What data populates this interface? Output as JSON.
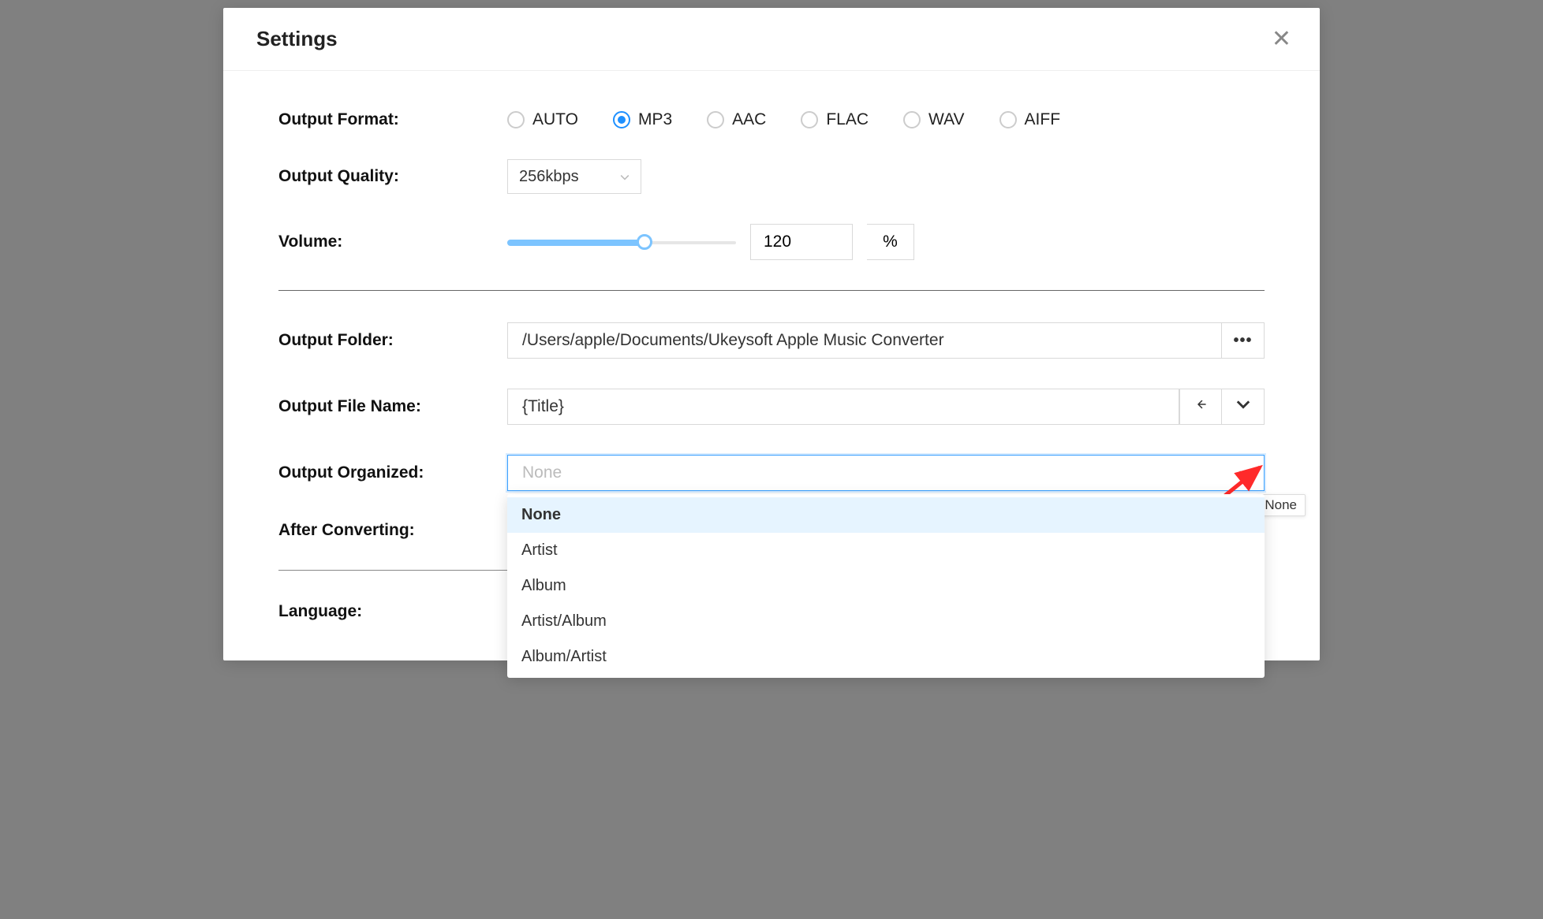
{
  "modal": {
    "title": "Settings"
  },
  "output_format": {
    "label": "Output Format:",
    "options": [
      "AUTO",
      "MP3",
      "AAC",
      "FLAC",
      "WAV",
      "AIFF"
    ],
    "selected": "MP3"
  },
  "output_quality": {
    "label": "Output Quality:",
    "value": "256kbps"
  },
  "volume": {
    "label": "Volume:",
    "value": "120",
    "unit": "%",
    "percent": 60
  },
  "output_folder": {
    "label": "Output Folder:",
    "value": "/Users/apple/Documents/Ukeysoft Apple Music Converter"
  },
  "output_file_name": {
    "label": "Output File Name:",
    "value": "{Title}"
  },
  "output_organized": {
    "label": "Output Organized:",
    "placeholder": "None",
    "options": [
      "None",
      "Artist",
      "Album",
      "Artist/Album",
      "Album/Artist"
    ],
    "selected": "None",
    "tooltip": "None"
  },
  "after_converting": {
    "label": "After Converting:"
  },
  "language": {
    "label": "Language:"
  }
}
